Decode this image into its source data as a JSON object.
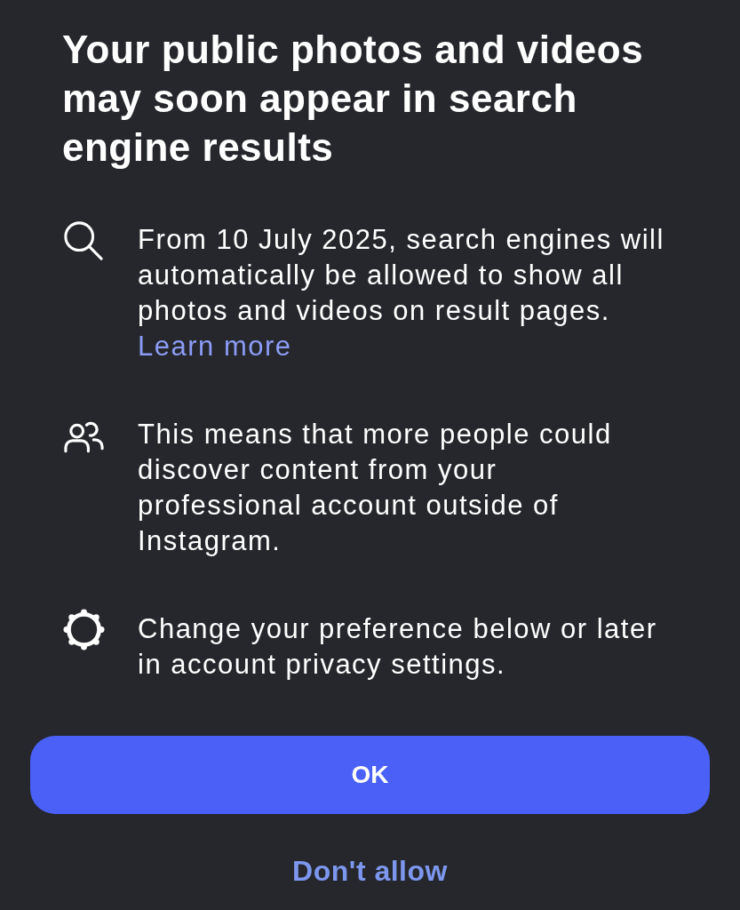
{
  "title": "Your public photos and videos may soon appear in search engine results",
  "items": [
    {
      "text": "From 10 July 2025, search engines will automatically be allowed to show all photos and videos on result pages.",
      "link": "Learn more"
    },
    {
      "text": "This means that more people could discover content from your professional account outside of Instagram."
    },
    {
      "text": "Change your preference below or later in account privacy settings."
    }
  ],
  "buttons": [
    {
      "label": "OK",
      "kind": "primary"
    },
    {
      "label": "Don't allow",
      "kind": "text"
    }
  ]
}
